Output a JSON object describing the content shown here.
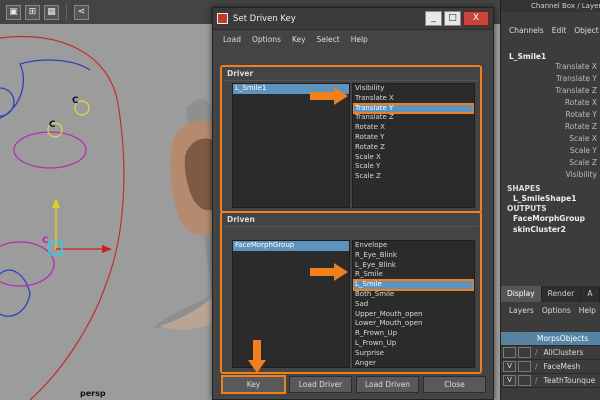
{
  "viewport": {
    "toolbar_icons": [
      "frame-all-icon",
      "grid-icon",
      "layout-icon",
      "share-icon"
    ],
    "camera_label": "persp",
    "cluster_labels": [
      "C",
      "C",
      "C"
    ]
  },
  "dialog": {
    "title": "Set Driven Key",
    "window_buttons": [
      "_",
      "□",
      "X"
    ],
    "menu": [
      "Load",
      "Options",
      "Key",
      "Select",
      "Help"
    ],
    "driver": {
      "label": "Driver",
      "objects": [
        "L_Smile1"
      ],
      "attributes": [
        "Visibility",
        "Translate X",
        "Translate Y",
        "Translate Z",
        "Rotate X",
        "Rotate Y",
        "Rotate Z",
        "Scale X",
        "Scale Y",
        "Scale Z"
      ]
    },
    "driven": {
      "label": "Driven",
      "objects": [
        "FaceMorphGroup"
      ],
      "attributes": [
        "Envelope",
        "R_Eye_Blink",
        "L_Eye_Blink",
        "R_Smile",
        "L_Smile",
        "Both_Smile",
        "Sad",
        "Upper_Mouth_open",
        "Lower_Mouth_open",
        "R_Frown_Up",
        "L_Frown_Up",
        "Surprise",
        "Anger"
      ]
    },
    "buttons": [
      "Key",
      "Load Driver",
      "Load Driven",
      "Close"
    ]
  },
  "channel_box": {
    "title": "Channel Box / Layer Edi",
    "menu": [
      "Channels",
      "Edit",
      "Object",
      "S"
    ],
    "node": "L_Smile1",
    "attributes": [
      "Translate X",
      "Translate Y",
      "Translate Z",
      "Rotate X",
      "Rotate Y",
      "Rotate Z",
      "Scale X",
      "Scale Y",
      "Scale Z",
      "Visibility"
    ],
    "shapes_label": "SHAPES",
    "shapes": [
      "L_SmileShape1"
    ],
    "outputs_label": "OUTPUTS",
    "outputs": [
      "FaceMorphGroup",
      "skinCluster2"
    ]
  },
  "layer_editor": {
    "tabs": [
      "Display",
      "Render",
      "A"
    ],
    "menu": [
      "Layers",
      "Options",
      "Help"
    ],
    "layers": [
      {
        "v": "",
        "name": "MorpsObjects",
        "selected": true
      },
      {
        "v": "",
        "name": "AllClusters",
        "selected": false
      },
      {
        "v": "V",
        "name": "FaceMesh",
        "selected": false
      },
      {
        "v": "V",
        "name": "TeathTounque",
        "selected": false
      }
    ]
  },
  "colors": {
    "highlight_orange": "#f0801e",
    "selection_blue": "#5e93bd",
    "viewport_bg": "#9c9c9c"
  }
}
